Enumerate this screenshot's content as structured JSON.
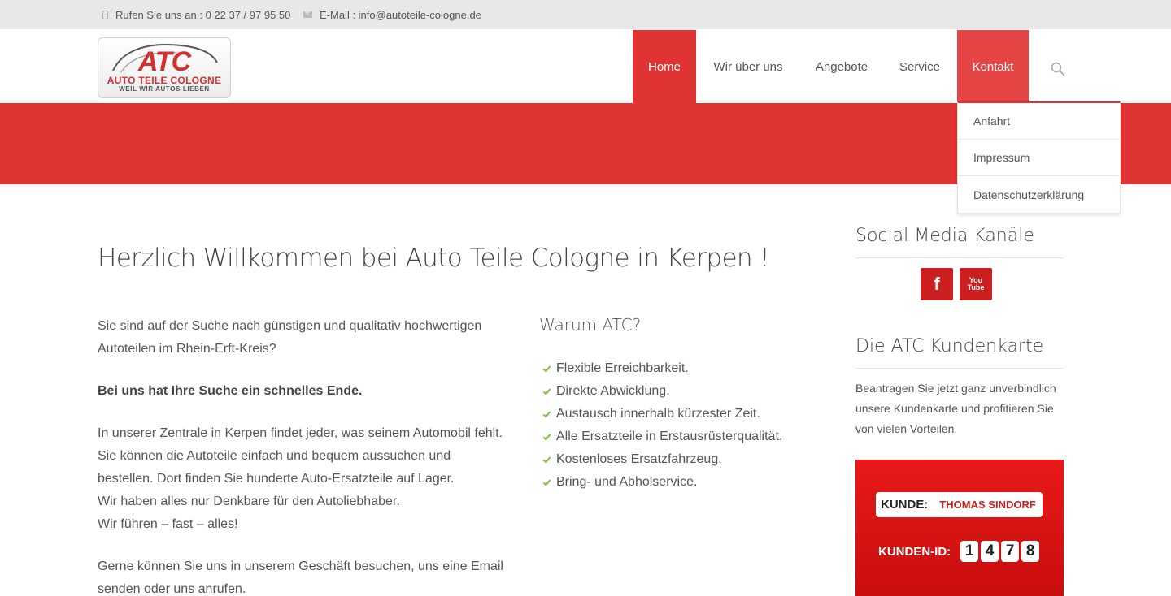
{
  "topbar": {
    "phone": "Rufen Sie uns an : 0 22 37 / 97 95 50",
    "email": "E-Mail : info@autoteile-cologne.de"
  },
  "logo": {
    "main": "ATC",
    "name": "AUTO TEILE COLOGNE",
    "tagline": "WEIL WIR AUTOS LIEBEN"
  },
  "nav": {
    "items": [
      {
        "label": "Home"
      },
      {
        "label": "Wir über uns"
      },
      {
        "label": "Angebote"
      },
      {
        "label": "Service"
      },
      {
        "label": "Kontakt"
      }
    ],
    "dropdown": [
      {
        "label": "Anfahrt"
      },
      {
        "label": "Impressum"
      },
      {
        "label": "Datenschutzerklärung"
      }
    ]
  },
  "main": {
    "title": "Herzlich Willkommen bei Auto Teile Cologne in Kerpen !",
    "p1": "Sie sind auf der Suche nach günstigen und qualitativ hochwertigen Autoteilen im Rhein-Erft-Kreis?",
    "p2": "Bei uns hat Ihre Suche ein schnelles Ende.",
    "p3_lines": [
      "In unserer Zentrale in Kerpen findet jeder, was seinem Automobil fehlt.",
      "Sie können die Autoteile einfach und bequem aussuchen und",
      "bestellen. Dort finden Sie hunderte Auto-Ersatzteile auf Lager.",
      "Wir haben alles nur Denkbare für den Autoliebhaber.",
      "Wir führen – fast – alles!"
    ],
    "p4": "Gerne können Sie uns in unserem Geschäft besuchen, uns eine Email senden oder uns anrufen.",
    "warum_title": "Warum ATC?",
    "warum_items": [
      "Flexible Erreichbarkeit.",
      "Direkte Abwicklung.",
      "Austausch innerhalb kürzester Zeit.",
      "Alle Ersatzteile in Erstausrüsterqualität.",
      "Kostenloses Ersatzfahrzeug.",
      "Bring- und Abholservice."
    ]
  },
  "sidebar": {
    "social_title": "Social Media Kanäle",
    "facebook_glyph": "f",
    "youtube_glyph_top": "You",
    "youtube_glyph_bottom": "Tube",
    "card_title": "Die ATC Kundenkarte",
    "card_text": "Beantragen Sie jetzt ganz unverbindlich unsere Kundenkarte und profitieren Sie von vielen Vorteilen.",
    "card": {
      "kunde_label": "KUNDE:",
      "kunde_name": "THOMAS SINDORF",
      "id_label": "KUNDEN-ID:",
      "id_digits": [
        "1",
        "4",
        "7",
        "8"
      ]
    }
  },
  "colors": {
    "accent": "#e03434",
    "check": "#7cc142"
  }
}
